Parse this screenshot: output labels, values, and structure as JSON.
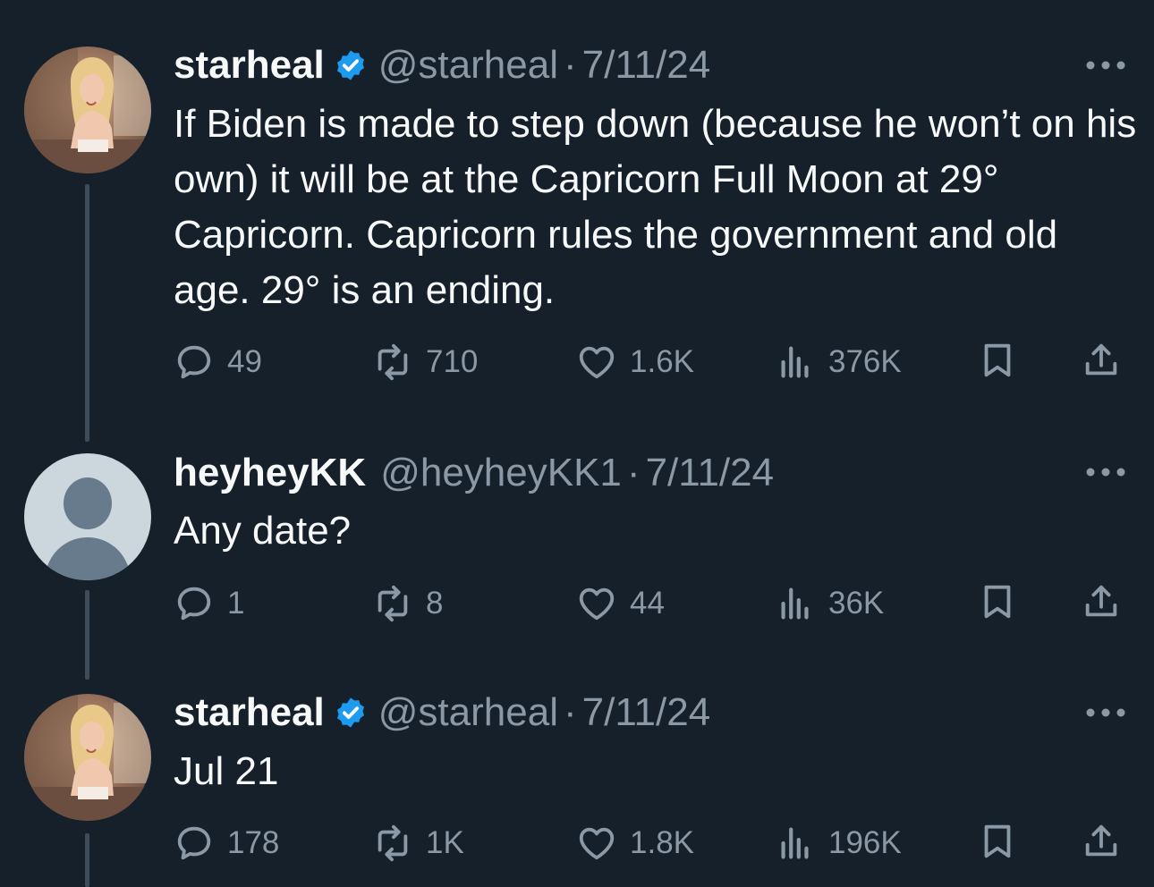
{
  "tweets": [
    {
      "name": "starheal",
      "verified": true,
      "handle": "@starheal",
      "separator": "·",
      "date": "7/11/24",
      "text": "If Biden is made to step down (because he won’t on his own) it will be at the Capricorn Full Moon at 29° Capricorn. Capricorn rules the government and old age. 29° is an ending.",
      "replies": "49",
      "reposts": "710",
      "likes": "1.6K",
      "views": "376K"
    },
    {
      "name": "heyheyKK",
      "verified": false,
      "handle": "@heyheyKK1",
      "separator": "·",
      "date": "7/11/24",
      "text": "Any date?",
      "replies": "1",
      "reposts": "8",
      "likes": "44",
      "views": "36K"
    },
    {
      "name": "starheal",
      "verified": true,
      "handle": "@starheal",
      "separator": "·",
      "date": "7/11/24",
      "text": "Jul 21",
      "replies": "178",
      "reposts": "1K",
      "likes": "1.8K",
      "views": "196K"
    }
  ],
  "icons": {
    "reply": "reply-icon",
    "repost": "repost-icon",
    "like": "heart-icon",
    "views": "views-icon",
    "bookmark": "bookmark-icon",
    "share": "share-icon",
    "more": "more-icon",
    "verified": "verified-badge-icon"
  },
  "colors": {
    "background": "#15202b",
    "text": "#f7f9f9",
    "muted": "#8b98a5",
    "verified": "#1d9bf0",
    "thread_line": "#3e4c59"
  }
}
